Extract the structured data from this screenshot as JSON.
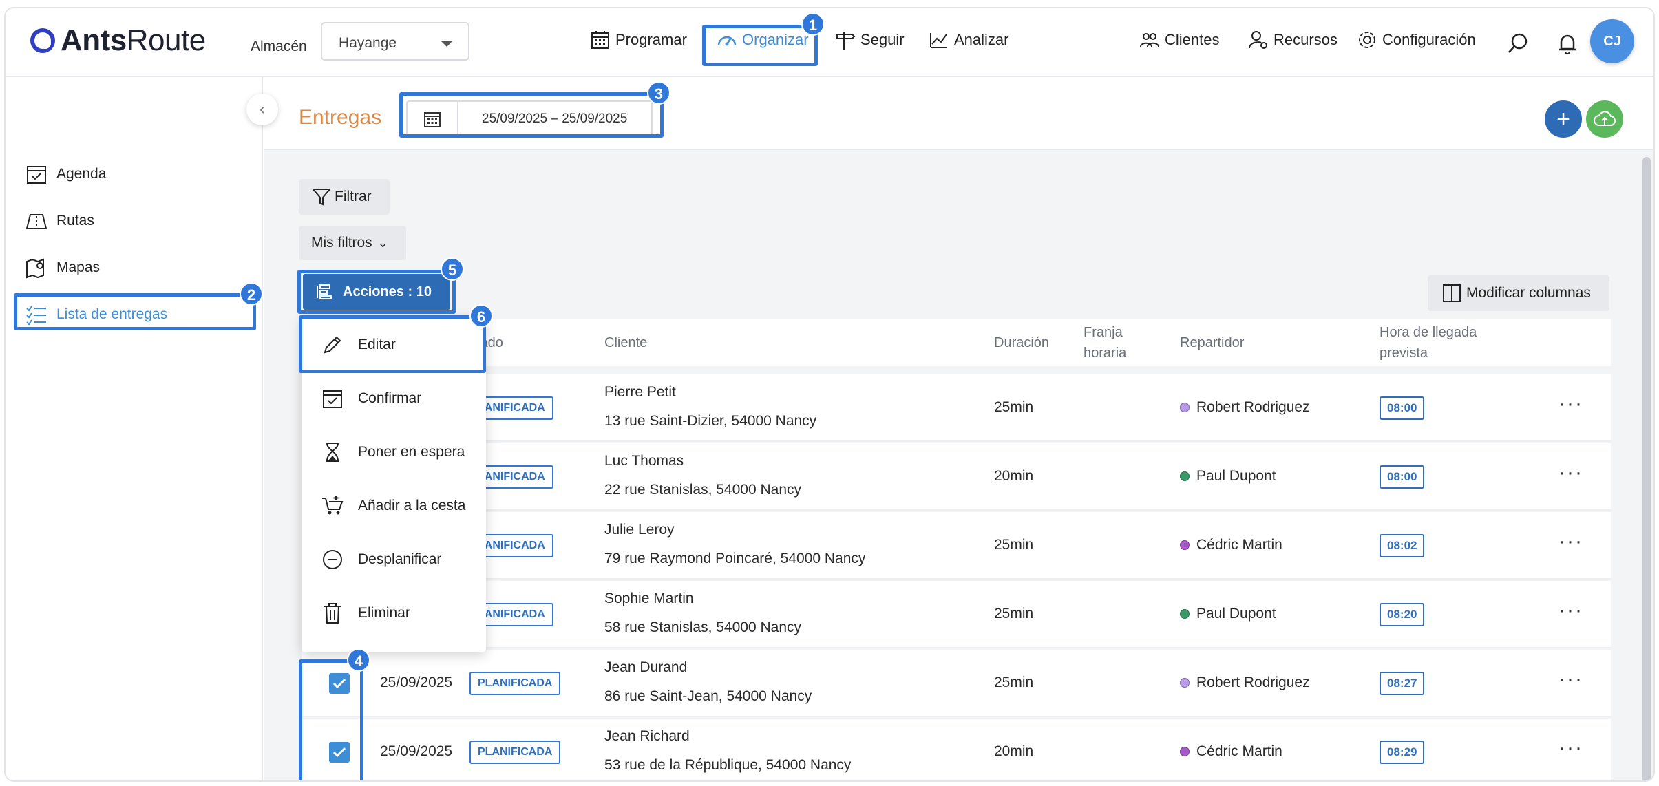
{
  "app": {
    "logo_text_bold": "Ants",
    "logo_text_light": "Route",
    "warehouse_label": "Almacén",
    "warehouse_value": "Hayange",
    "avatar_initials": "CJ",
    "brand_color": "#2f78d9",
    "accent_orange": "#d98a4a"
  },
  "nav": {
    "programar": "Programar",
    "organizar": "Organizar",
    "seguir": "Seguir",
    "analizar": "Analizar",
    "clientes": "Clientes",
    "recursos": "Recursos",
    "configuracion": "Configuración"
  },
  "sidebar": {
    "items": [
      {
        "label": "Agenda",
        "icon": "calendar-check-icon"
      },
      {
        "label": "Rutas",
        "icon": "route-map-icon"
      },
      {
        "label": "Mapas",
        "icon": "map-pin-icon"
      },
      {
        "label": "Lista de entregas",
        "icon": "list-check-icon",
        "active": true
      }
    ]
  },
  "header": {
    "title": "Entregas",
    "date_range": "25/09/2025 – 25/09/2025"
  },
  "toolbar": {
    "filter_label": "Filtrar",
    "my_filters_label": "Mis filtros",
    "actions_label": "Acciones : 10",
    "modify_columns_label": "Modificar columnas"
  },
  "table": {
    "columns": {
      "estado": "tado",
      "cliente": "Cliente",
      "duracion": "Duración",
      "franja": "Franja\nhoraria",
      "repartidor": "Repartidor",
      "hora": "Hora de llegada\nprevista"
    },
    "rows": [
      {
        "date": "",
        "status": "LANIFICADA",
        "client": "Pierre Petit",
        "address": "13 rue Saint-Dizier, 54000 Nancy",
        "duration": "25min",
        "driver": "Robert Rodriguez",
        "driver_color": "#b79ae8",
        "eta": "08:00",
        "checked": false
      },
      {
        "date": "",
        "status": "LANIFICADA",
        "client": "Luc Thomas",
        "address": "22 rue Stanislas, 54000 Nancy",
        "duration": "20min",
        "driver": "Paul Dupont",
        "driver_color": "#3a9a6a",
        "eta": "08:00",
        "checked": false
      },
      {
        "date": "",
        "status": "LANIFICADA",
        "client": "Julie Leroy",
        "address": "79 rue Raymond Poincaré, 54000 Nancy",
        "duration": "25min",
        "driver": "Cédric Martin",
        "driver_color": "#a65bc9",
        "eta": "08:02",
        "checked": false
      },
      {
        "date": "",
        "status": "LANIFICADA",
        "client": "Sophie Martin",
        "address": "58 rue Stanislas, 54000 Nancy",
        "duration": "25min",
        "driver": "Paul Dupont",
        "driver_color": "#3a9a6a",
        "eta": "08:20",
        "checked": false
      },
      {
        "date": "25/09/2025",
        "status": "PLANIFICADA",
        "client": "Jean Durand",
        "address": "86 rue Saint-Jean, 54000 Nancy",
        "duration": "25min",
        "driver": "Robert Rodriguez",
        "driver_color": "#b79ae8",
        "eta": "08:27",
        "checked": true
      },
      {
        "date": "25/09/2025",
        "status": "PLANIFICADA",
        "client": "Jean Richard",
        "address": "53 rue de la République, 54000 Nancy",
        "duration": "20min",
        "driver": "Cédric Martin",
        "driver_color": "#a65bc9",
        "eta": "08:29",
        "checked": true
      }
    ]
  },
  "actions_menu": {
    "items": [
      {
        "label": "Editar",
        "icon": "pencil-icon"
      },
      {
        "label": "Confirmar",
        "icon": "calendar-check-icon"
      },
      {
        "label": "Poner en espera",
        "icon": "hourglass-icon"
      },
      {
        "label": "Añadir a la cesta",
        "icon": "basket-icon"
      },
      {
        "label": "Desplanificar",
        "icon": "minus-circle-icon"
      },
      {
        "label": "Eliminar",
        "icon": "trash-icon"
      }
    ]
  },
  "annotations": [
    "1",
    "2",
    "3",
    "4",
    "5",
    "6"
  ]
}
